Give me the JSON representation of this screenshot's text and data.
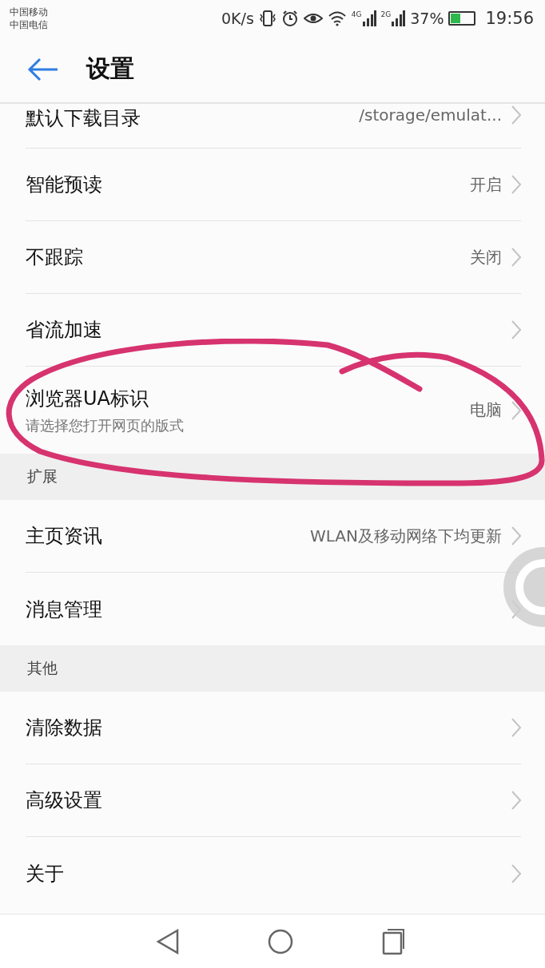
{
  "status_bar": {
    "carriers": [
      "中国移动",
      "中国电信"
    ],
    "speed": "0K/s",
    "networks": [
      "4G",
      "2G"
    ],
    "battery": "37%",
    "time": "19:56"
  },
  "header": {
    "title": "设置"
  },
  "groups": [
    {
      "items": [
        {
          "title": "默认下载目录",
          "value": "/storage/emulat..."
        },
        {
          "title": "智能预读",
          "value": "开启"
        },
        {
          "title": "不跟踪",
          "value": "关闭"
        },
        {
          "title": "省流加速"
        },
        {
          "title": "浏览器UA标识",
          "subtitle": "请选择您打开网页的版式",
          "value": "电脑"
        }
      ]
    },
    {
      "title": "扩展",
      "items": [
        {
          "title": "主页资讯",
          "value": "WLAN及移动网络下均更新"
        },
        {
          "title": "消息管理"
        }
      ]
    },
    {
      "title": "其他",
      "items": [
        {
          "title": "清除数据"
        },
        {
          "title": "高级设置"
        },
        {
          "title": "关于"
        }
      ]
    }
  ]
}
